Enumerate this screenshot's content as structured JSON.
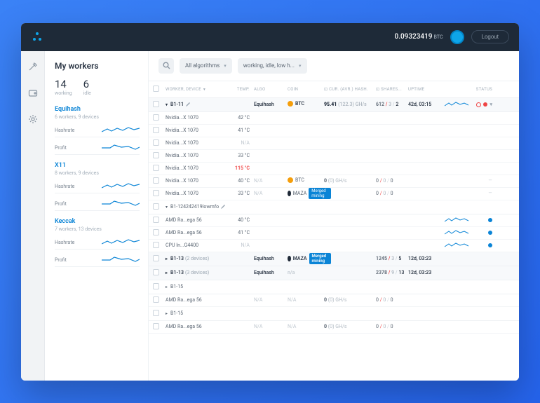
{
  "topbar": {
    "balance_value": "0.09323419",
    "balance_unit": "BTC",
    "logout_label": "Logout"
  },
  "sidebar": {
    "title": "My workers",
    "stats": [
      {
        "num": "14",
        "label": "working"
      },
      {
        "num": "6",
        "label": "idle"
      }
    ],
    "algos": [
      {
        "name": "Equihash",
        "sub": "6 workers, 9 devices",
        "metrics": [
          {
            "label": "Hashrate"
          },
          {
            "label": "Profit"
          }
        ]
      },
      {
        "name": "X11",
        "sub": "8 workers, 9 devices",
        "metrics": [
          {
            "label": "Hashrate"
          },
          {
            "label": "Profit"
          }
        ]
      },
      {
        "name": "Keccak",
        "sub": "7 workers, 13 devices",
        "metrics": [
          {
            "label": "Hashrate"
          },
          {
            "label": "Profit"
          }
        ]
      }
    ]
  },
  "filters": {
    "algo": "All algorithms",
    "status": "working, idle, low h..."
  },
  "columns": {
    "worker": "WORKER, DEVICE",
    "temp": "TEMP.",
    "algo": "ALGO",
    "coin": "COIN",
    "hash": "CUR. (AVR.) HASH.",
    "shares": "SHARES...",
    "uptime": "UPTIME",
    "status": "STATUS"
  },
  "groups": [
    {
      "id": "b1_11",
      "label": "B1-11",
      "expanded": true,
      "highlight": true,
      "summary": {
        "algo": "Equihash",
        "coin": "BTC",
        "coin_color": "orange",
        "hash": "95.41",
        "hash_sub": "(122.3) GH/s",
        "shares": [
          "612",
          "3",
          "2"
        ],
        "uptime": "42d, 03:15",
        "status": "ring-red"
      },
      "devices": [
        {
          "name": "Nvidia...X 1070",
          "temp": "42 °C",
          "temp_class": "ok"
        },
        {
          "name": "Nvidia...X 1070",
          "temp": "41 °C",
          "temp_class": "ok"
        },
        {
          "name": "Nvidia...X 1070",
          "temp": "N/A",
          "temp_class": "na"
        },
        {
          "name": "Nvidia...X 1070",
          "temp": "33 °C",
          "temp_class": "ok"
        },
        {
          "name": "Nvidia...X 1070",
          "temp": "115 °C",
          "temp_class": "hot"
        },
        {
          "name": "Nvidia...X 1070",
          "temp": "40 °C",
          "temp_class": "ok",
          "algo": "N/A",
          "coin": "BTC",
          "coin_color": "orange",
          "hash": "0",
          "hash_sub": "(0) GH/s",
          "shares": [
            "0",
            "0",
            "0"
          ],
          "status": "dash"
        },
        {
          "name": "Nvidia...X 1070",
          "temp": "33 °C",
          "temp_class": "ok",
          "algo": "N/A",
          "coin": "MAZA",
          "coin_color": "dark",
          "tag": "Merged mining",
          "shares": [
            "0",
            "0",
            "0"
          ],
          "status": "dash"
        }
      ]
    },
    {
      "id": "b1_12",
      "label": "B1-124242419lowmfo",
      "expanded": true,
      "devices": [
        {
          "name": "AMD Ra...ega 56",
          "temp": "40 °C",
          "temp_class": "ok",
          "status": "blue",
          "graph": true
        },
        {
          "name": "AMD Ra...ega 56",
          "temp": "41 °C",
          "temp_class": "ok",
          "status": "blue",
          "graph": true
        },
        {
          "name": "CPU In...G4400",
          "temp": "N/A",
          "temp_class": "na",
          "status": "blue",
          "graph": true
        }
      ]
    },
    {
      "id": "b1_13a",
      "label": "B1-13",
      "count": "(2 devices)",
      "highlight": true,
      "summary": {
        "algo": "Equihash",
        "coin": "MAZA",
        "coin_color": "dark",
        "tag": "Merged mining",
        "shares": [
          "1245",
          "3",
          "5"
        ],
        "uptime": "12d, 03:23"
      }
    },
    {
      "id": "b1_13b",
      "label": "B1-13",
      "count": "(3 devices)",
      "highlight": true,
      "summary": {
        "algo": "Equihash",
        "coin_na": "n/a",
        "shares": [
          "2378",
          "9",
          "13"
        ],
        "uptime": "12d, 03:23"
      }
    },
    {
      "id": "b1_15a",
      "label": "B1-15",
      "devices": [
        {
          "name": "AMD Ra...ega 56",
          "temp_class": "na",
          "algo": "N/A",
          "coin_na": "N/A",
          "hash": "0",
          "hash_sub": "(0) GH/s",
          "shares": [
            "0",
            "0",
            "0"
          ]
        }
      ]
    },
    {
      "id": "b1_15b",
      "label": "B1-15",
      "devices": [
        {
          "name": "AMD Ra...ega 56",
          "temp_class": "na",
          "algo": "N/A",
          "coin_na": "N/A",
          "hash": "0",
          "hash_sub": "(0) GH/s",
          "shares": [
            "0",
            "0",
            "0"
          ]
        }
      ]
    }
  ]
}
